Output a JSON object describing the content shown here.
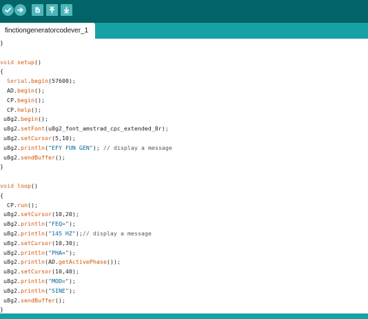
{
  "toolbar": {
    "buttons": [
      {
        "name": "verify-button",
        "icon": "checkmark-icon"
      },
      {
        "name": "upload-button",
        "icon": "arrow-right-icon"
      },
      {
        "name": "new-button",
        "icon": "new-file-icon"
      },
      {
        "name": "open-button",
        "icon": "arrow-up-icon"
      },
      {
        "name": "save-button",
        "icon": "arrow-down-icon"
      }
    ],
    "colors": {
      "background": "#006468",
      "button": "#4db7bb"
    }
  },
  "tabs": [
    {
      "label": "finctiongeneratorcodever_1"
    }
  ],
  "editor": {
    "lines": [
      {
        "parts": [
          {
            "t": "}",
            "c": ""
          }
        ]
      },
      {
        "parts": [
          {
            "t": "",
            "c": ""
          }
        ]
      },
      {
        "parts": [
          {
            "t": "void",
            "c": "kw"
          },
          {
            "t": " ",
            "c": ""
          },
          {
            "t": "setup",
            "c": "fn"
          },
          {
            "t": "()",
            "c": ""
          }
        ]
      },
      {
        "parts": [
          {
            "t": "{",
            "c": ""
          }
        ]
      },
      {
        "parts": [
          {
            "t": "  ",
            "c": ""
          },
          {
            "t": "Serial",
            "c": "ty"
          },
          {
            "t": ".",
            "c": ""
          },
          {
            "t": "begin",
            "c": "fn"
          },
          {
            "t": "(57600);",
            "c": ""
          }
        ]
      },
      {
        "parts": [
          {
            "t": "  AD.",
            "c": ""
          },
          {
            "t": "begin",
            "c": "fn"
          },
          {
            "t": "();",
            "c": ""
          }
        ]
      },
      {
        "parts": [
          {
            "t": "  CP.",
            "c": ""
          },
          {
            "t": "begin",
            "c": "fn"
          },
          {
            "t": "();",
            "c": ""
          }
        ]
      },
      {
        "parts": [
          {
            "t": "  CP.",
            "c": ""
          },
          {
            "t": "help",
            "c": "fn"
          },
          {
            "t": "();",
            "c": ""
          }
        ]
      },
      {
        "parts": [
          {
            "t": " u8g2.",
            "c": ""
          },
          {
            "t": "begin",
            "c": "fn"
          },
          {
            "t": "();",
            "c": ""
          }
        ]
      },
      {
        "parts": [
          {
            "t": " u8g2.",
            "c": ""
          },
          {
            "t": "setFont",
            "c": "fn"
          },
          {
            "t": "(u8g2_font_amstrad_cpc_extended_8r);",
            "c": ""
          }
        ]
      },
      {
        "parts": [
          {
            "t": " u8g2.",
            "c": ""
          },
          {
            "t": "setCursor",
            "c": "fn"
          },
          {
            "t": "(5,10);",
            "c": ""
          }
        ]
      },
      {
        "parts": [
          {
            "t": " u8g2.",
            "c": ""
          },
          {
            "t": "println",
            "c": "fn"
          },
          {
            "t": "(",
            "c": ""
          },
          {
            "t": "\"EFY FUN GEN\"",
            "c": "str"
          },
          {
            "t": "); ",
            "c": ""
          },
          {
            "t": "// display a message",
            "c": "cmt"
          }
        ]
      },
      {
        "parts": [
          {
            "t": " u8g2.",
            "c": ""
          },
          {
            "t": "sendBuffer",
            "c": "fn"
          },
          {
            "t": "();",
            "c": ""
          }
        ]
      },
      {
        "parts": [
          {
            "t": "}",
            "c": ""
          }
        ]
      },
      {
        "parts": [
          {
            "t": "",
            "c": ""
          }
        ]
      },
      {
        "parts": [
          {
            "t": "void",
            "c": "kw"
          },
          {
            "t": " ",
            "c": ""
          },
          {
            "t": "loop",
            "c": "fn"
          },
          {
            "t": "()",
            "c": ""
          }
        ]
      },
      {
        "parts": [
          {
            "t": "{",
            "c": ""
          }
        ]
      },
      {
        "parts": [
          {
            "t": "  CP.",
            "c": ""
          },
          {
            "t": "run",
            "c": "fn"
          },
          {
            "t": "();",
            "c": ""
          }
        ]
      },
      {
        "parts": [
          {
            "t": " u8g2.",
            "c": ""
          },
          {
            "t": "setCursor",
            "c": "fn"
          },
          {
            "t": "(10,20);",
            "c": ""
          }
        ]
      },
      {
        "parts": [
          {
            "t": " u8g2.",
            "c": ""
          },
          {
            "t": "println",
            "c": "fn"
          },
          {
            "t": "(",
            "c": ""
          },
          {
            "t": "\"FEQ=\"",
            "c": "str"
          },
          {
            "t": ");",
            "c": ""
          }
        ]
      },
      {
        "parts": [
          {
            "t": " u8g2.",
            "c": ""
          },
          {
            "t": "println",
            "c": "fn"
          },
          {
            "t": "(",
            "c": ""
          },
          {
            "t": "\"145 HZ\"",
            "c": "str"
          },
          {
            "t": ");",
            "c": ""
          },
          {
            "t": "// display a message",
            "c": "cmt"
          }
        ]
      },
      {
        "parts": [
          {
            "t": " u8g2.",
            "c": ""
          },
          {
            "t": "setCursor",
            "c": "fn"
          },
          {
            "t": "(10,30);",
            "c": ""
          }
        ]
      },
      {
        "parts": [
          {
            "t": " u8g2.",
            "c": ""
          },
          {
            "t": "println",
            "c": "fn"
          },
          {
            "t": "(",
            "c": ""
          },
          {
            "t": "\"PHA=\"",
            "c": "str"
          },
          {
            "t": ");",
            "c": ""
          }
        ]
      },
      {
        "parts": [
          {
            "t": " u8g2.",
            "c": ""
          },
          {
            "t": "println",
            "c": "fn"
          },
          {
            "t": "(AD.",
            "c": ""
          },
          {
            "t": "getActivePhase",
            "c": "fn"
          },
          {
            "t": "());",
            "c": ""
          }
        ]
      },
      {
        "parts": [
          {
            "t": " u8g2.",
            "c": ""
          },
          {
            "t": "setCursor",
            "c": "fn"
          },
          {
            "t": "(10,40);",
            "c": ""
          }
        ]
      },
      {
        "parts": [
          {
            "t": " u8g2.",
            "c": ""
          },
          {
            "t": "println",
            "c": "fn"
          },
          {
            "t": "(",
            "c": ""
          },
          {
            "t": "\"MOD=\"",
            "c": "str"
          },
          {
            "t": ");",
            "c": ""
          }
        ]
      },
      {
        "parts": [
          {
            "t": " u8g2.",
            "c": ""
          },
          {
            "t": "println",
            "c": "fn"
          },
          {
            "t": "(",
            "c": ""
          },
          {
            "t": "\"SINE\"",
            "c": "str"
          },
          {
            "t": ");",
            "c": ""
          }
        ]
      },
      {
        "parts": [
          {
            "t": " u8g2.",
            "c": ""
          },
          {
            "t": "sendBuffer",
            "c": "fn"
          },
          {
            "t": "();",
            "c": ""
          }
        ]
      },
      {
        "parts": [
          {
            "t": "}",
            "c": ""
          }
        ]
      }
    ]
  }
}
